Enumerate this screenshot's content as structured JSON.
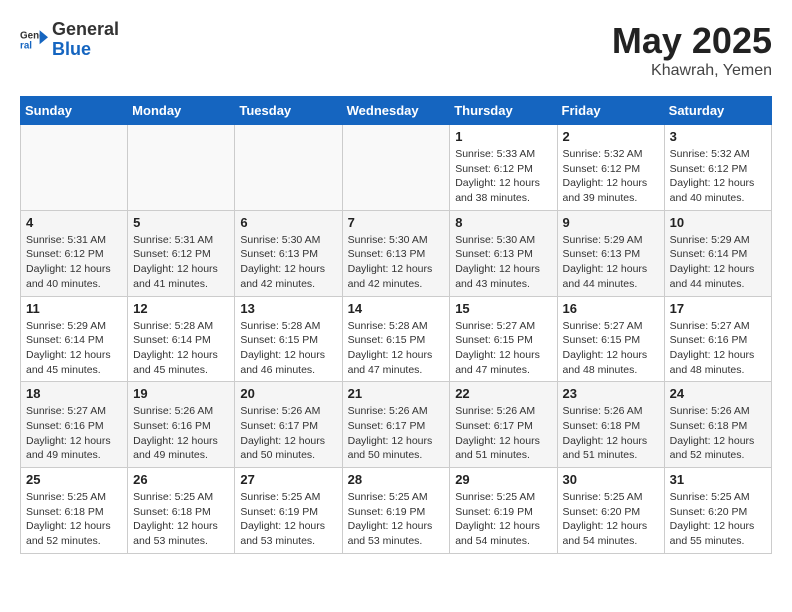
{
  "header": {
    "logo_general": "General",
    "logo_blue": "Blue",
    "month": "May 2025",
    "location": "Khawrah, Yemen"
  },
  "weekdays": [
    "Sunday",
    "Monday",
    "Tuesday",
    "Wednesday",
    "Thursday",
    "Friday",
    "Saturday"
  ],
  "weeks": [
    [
      {
        "day": "",
        "info": ""
      },
      {
        "day": "",
        "info": ""
      },
      {
        "day": "",
        "info": ""
      },
      {
        "day": "",
        "info": ""
      },
      {
        "day": "1",
        "info": "Sunrise: 5:33 AM\nSunset: 6:12 PM\nDaylight: 12 hours\nand 38 minutes."
      },
      {
        "day": "2",
        "info": "Sunrise: 5:32 AM\nSunset: 6:12 PM\nDaylight: 12 hours\nand 39 minutes."
      },
      {
        "day": "3",
        "info": "Sunrise: 5:32 AM\nSunset: 6:12 PM\nDaylight: 12 hours\nand 40 minutes."
      }
    ],
    [
      {
        "day": "4",
        "info": "Sunrise: 5:31 AM\nSunset: 6:12 PM\nDaylight: 12 hours\nand 40 minutes."
      },
      {
        "day": "5",
        "info": "Sunrise: 5:31 AM\nSunset: 6:12 PM\nDaylight: 12 hours\nand 41 minutes."
      },
      {
        "day": "6",
        "info": "Sunrise: 5:30 AM\nSunset: 6:13 PM\nDaylight: 12 hours\nand 42 minutes."
      },
      {
        "day": "7",
        "info": "Sunrise: 5:30 AM\nSunset: 6:13 PM\nDaylight: 12 hours\nand 42 minutes."
      },
      {
        "day": "8",
        "info": "Sunrise: 5:30 AM\nSunset: 6:13 PM\nDaylight: 12 hours\nand 43 minutes."
      },
      {
        "day": "9",
        "info": "Sunrise: 5:29 AM\nSunset: 6:13 PM\nDaylight: 12 hours\nand 44 minutes."
      },
      {
        "day": "10",
        "info": "Sunrise: 5:29 AM\nSunset: 6:14 PM\nDaylight: 12 hours\nand 44 minutes."
      }
    ],
    [
      {
        "day": "11",
        "info": "Sunrise: 5:29 AM\nSunset: 6:14 PM\nDaylight: 12 hours\nand 45 minutes."
      },
      {
        "day": "12",
        "info": "Sunrise: 5:28 AM\nSunset: 6:14 PM\nDaylight: 12 hours\nand 45 minutes."
      },
      {
        "day": "13",
        "info": "Sunrise: 5:28 AM\nSunset: 6:15 PM\nDaylight: 12 hours\nand 46 minutes."
      },
      {
        "day": "14",
        "info": "Sunrise: 5:28 AM\nSunset: 6:15 PM\nDaylight: 12 hours\nand 47 minutes."
      },
      {
        "day": "15",
        "info": "Sunrise: 5:27 AM\nSunset: 6:15 PM\nDaylight: 12 hours\nand 47 minutes."
      },
      {
        "day": "16",
        "info": "Sunrise: 5:27 AM\nSunset: 6:15 PM\nDaylight: 12 hours\nand 48 minutes."
      },
      {
        "day": "17",
        "info": "Sunrise: 5:27 AM\nSunset: 6:16 PM\nDaylight: 12 hours\nand 48 minutes."
      }
    ],
    [
      {
        "day": "18",
        "info": "Sunrise: 5:27 AM\nSunset: 6:16 PM\nDaylight: 12 hours\nand 49 minutes."
      },
      {
        "day": "19",
        "info": "Sunrise: 5:26 AM\nSunset: 6:16 PM\nDaylight: 12 hours\nand 49 minutes."
      },
      {
        "day": "20",
        "info": "Sunrise: 5:26 AM\nSunset: 6:17 PM\nDaylight: 12 hours\nand 50 minutes."
      },
      {
        "day": "21",
        "info": "Sunrise: 5:26 AM\nSunset: 6:17 PM\nDaylight: 12 hours\nand 50 minutes."
      },
      {
        "day": "22",
        "info": "Sunrise: 5:26 AM\nSunset: 6:17 PM\nDaylight: 12 hours\nand 51 minutes."
      },
      {
        "day": "23",
        "info": "Sunrise: 5:26 AM\nSunset: 6:18 PM\nDaylight: 12 hours\nand 51 minutes."
      },
      {
        "day": "24",
        "info": "Sunrise: 5:26 AM\nSunset: 6:18 PM\nDaylight: 12 hours\nand 52 minutes."
      }
    ],
    [
      {
        "day": "25",
        "info": "Sunrise: 5:25 AM\nSunset: 6:18 PM\nDaylight: 12 hours\nand 52 minutes."
      },
      {
        "day": "26",
        "info": "Sunrise: 5:25 AM\nSunset: 6:18 PM\nDaylight: 12 hours\nand 53 minutes."
      },
      {
        "day": "27",
        "info": "Sunrise: 5:25 AM\nSunset: 6:19 PM\nDaylight: 12 hours\nand 53 minutes."
      },
      {
        "day": "28",
        "info": "Sunrise: 5:25 AM\nSunset: 6:19 PM\nDaylight: 12 hours\nand 53 minutes."
      },
      {
        "day": "29",
        "info": "Sunrise: 5:25 AM\nSunset: 6:19 PM\nDaylight: 12 hours\nand 54 minutes."
      },
      {
        "day": "30",
        "info": "Sunrise: 5:25 AM\nSunset: 6:20 PM\nDaylight: 12 hours\nand 54 minutes."
      },
      {
        "day": "31",
        "info": "Sunrise: 5:25 AM\nSunset: 6:20 PM\nDaylight: 12 hours\nand 55 minutes."
      }
    ]
  ]
}
